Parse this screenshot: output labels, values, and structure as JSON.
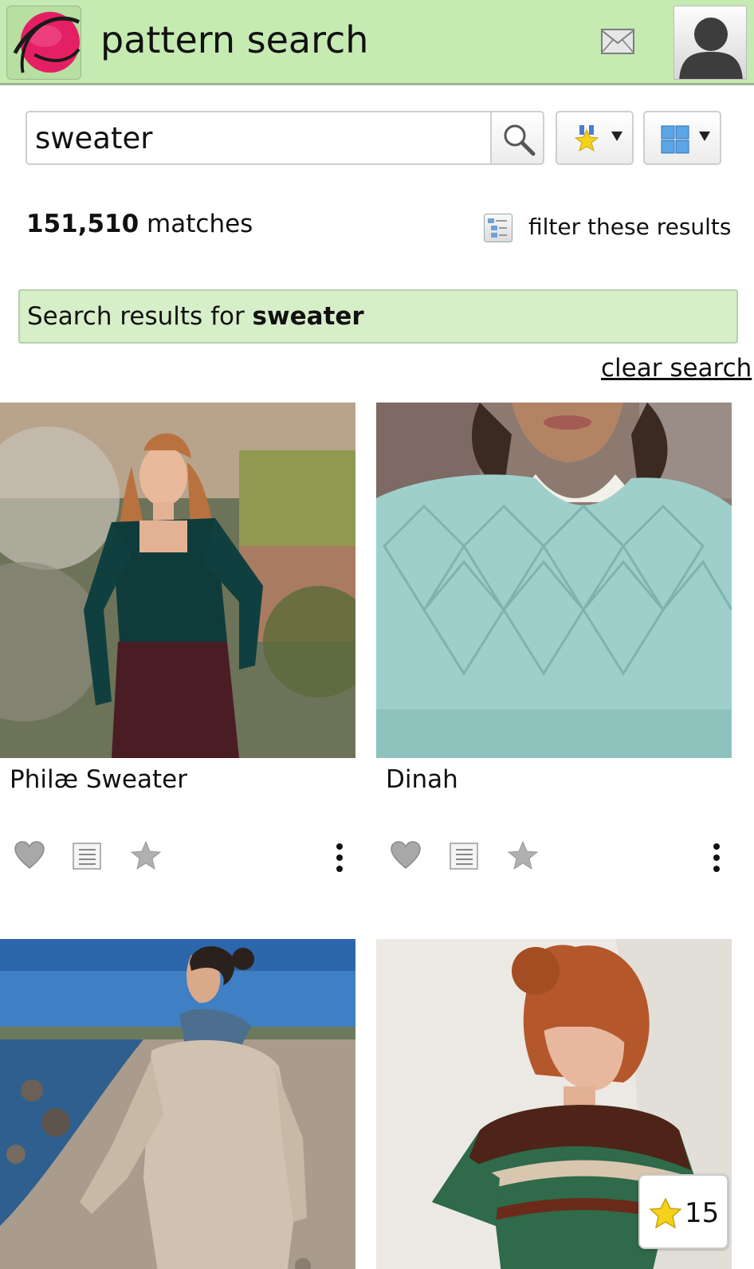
{
  "header": {
    "title": "pattern search",
    "icons": [
      "ravelry-logo",
      "mail-icon",
      "avatar-icon"
    ],
    "background": "#c5ebb2"
  },
  "search": {
    "query": "sweater",
    "placeholder": "",
    "search_icon": "magnifier-icon",
    "sort_icon": "star-ribbon-icon",
    "view_icon": "grid-view-icon"
  },
  "summary": {
    "count": "151,510",
    "count_suffix": " matches",
    "filter_label": "filter these results",
    "results_prefix": "Search results for ",
    "results_term": "sweater",
    "clear_label": "clear search"
  },
  "patterns": [
    {
      "title": "Philæ Sweater",
      "image": "woman-green-sweater-blossom-tree"
    },
    {
      "title": "Dinah",
      "image": "mint-lace-yoke-sweater"
    },
    {
      "title": "",
      "image": "woman-oatmeal-sweater-beach"
    },
    {
      "title": "",
      "image": "colorwork-yoke-tee"
    }
  ],
  "favorite_badge": {
    "count": "15"
  },
  "colors": {
    "accent": "#c5ebb2",
    "results_bar": "#d7efc9",
    "star": "#f5d21a"
  }
}
